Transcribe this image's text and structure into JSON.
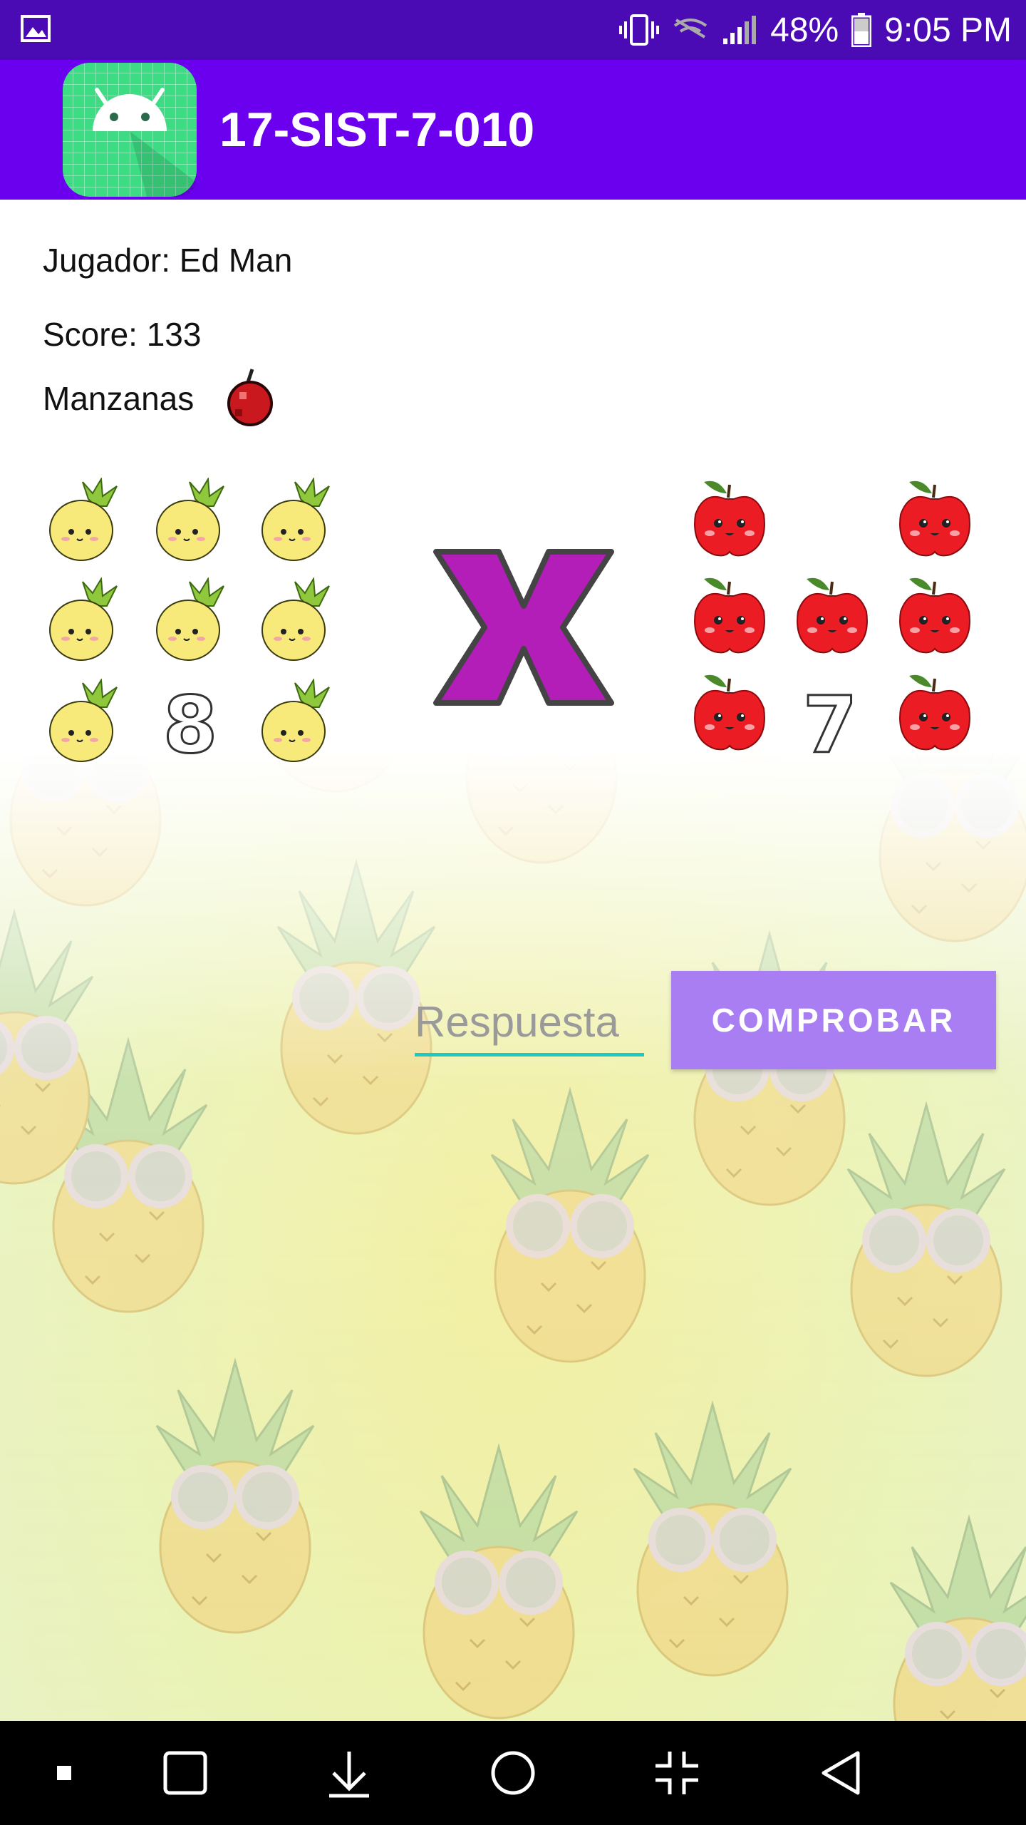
{
  "status_bar": {
    "battery": "48%",
    "time": "9:05 PM",
    "icons": [
      "gallery-icon",
      "vibrate-icon",
      "no-signal-icon",
      "signal-icon",
      "battery-icon"
    ]
  },
  "app_bar": {
    "title": "17-SIST-7-010",
    "icon": "android-icon"
  },
  "game": {
    "player_label": "Jugador: Ed Man",
    "score_label": "Score: 133",
    "fruit_label": "Manzanas",
    "fruit_icon": "apple-icon",
    "operand_left": {
      "fruit": "pineapple",
      "digit": "8"
    },
    "operator": "X",
    "operand_right": {
      "fruit": "apple",
      "digit": "7"
    }
  },
  "answer": {
    "placeholder": "Respuesta",
    "value": "",
    "button_label": "COMPROBAR"
  },
  "nav_bar": {
    "buttons": [
      "dot-icon",
      "recents-icon",
      "download-icon",
      "home-icon",
      "fullscreen-exit-icon",
      "back-icon"
    ]
  },
  "colors": {
    "status_bar": "#4a0bb5",
    "app_bar": "#6a00ee",
    "button": "#a87ef2",
    "input_underline": "#1ec9c3",
    "operator": "#b31db8"
  }
}
